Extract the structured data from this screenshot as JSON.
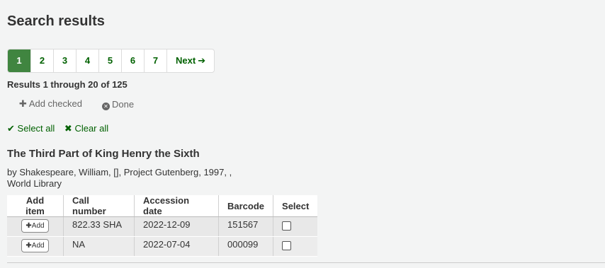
{
  "page": {
    "title": "Search results"
  },
  "pagination": {
    "pages": [
      "1",
      "2",
      "3",
      "4",
      "5",
      "6",
      "7"
    ],
    "next_label": "Next",
    "next_icon": "arrow-right-icon"
  },
  "results": {
    "summary": "Results 1 through 20 of 125"
  },
  "actions": {
    "add_checked": "Add checked",
    "done": "Done"
  },
  "selection": {
    "select_all": "Select all",
    "clear_all": "Clear all"
  },
  "record": {
    "title": "The Third Part of King Henry the Sixth",
    "meta_line1": "by Shakespeare, William, [], Project Gutenberg, 1997, ,",
    "meta_line2": "World Library"
  },
  "table": {
    "headers": [
      "Add item",
      "Call number",
      "Accession date",
      "Barcode",
      "Select"
    ],
    "add_label": "Add",
    "rows": [
      {
        "call_number": "822.33 SHA",
        "accession_date": "2022-12-09",
        "barcode": "151567",
        "selected": false
      },
      {
        "call_number": "NA",
        "accession_date": "2022-07-04",
        "barcode": "000099",
        "selected": false
      }
    ]
  },
  "colors": {
    "link": "#006100",
    "active_page": "#408540",
    "background": "#f3f4f4"
  }
}
